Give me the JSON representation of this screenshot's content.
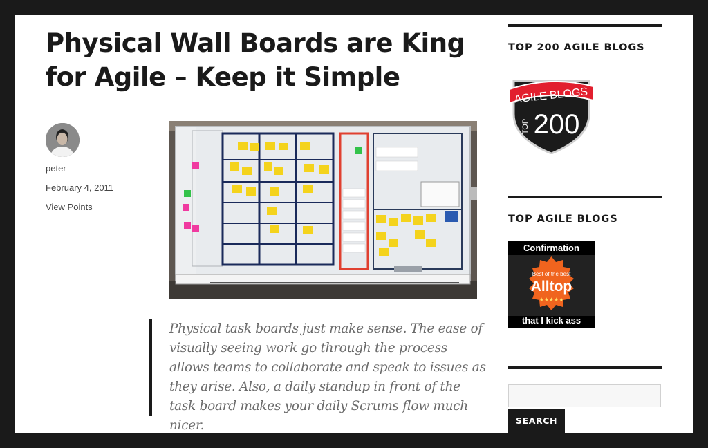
{
  "post": {
    "title": "Physical Wall Boards are King for Agile – Keep it Simple",
    "author": "peter",
    "date": "February 4, 2011",
    "category": "View Points",
    "quote": "Physical task boards just make sense. The ease of visually seeing work go through the process allows teams to collaborate and speak to issues as they arise. Also, a daily standup in front of the task board makes your daily Scrums flow much nicer."
  },
  "sidebar": {
    "widget1": {
      "title": "TOP 200 AGILE BLOGS",
      "badge_line1": "AGILE BLOGS",
      "badge_side": "TOP",
      "badge_number": "200"
    },
    "widget2": {
      "title": "TOP AGILE BLOGS",
      "badge_top": "Confirmation",
      "badge_small": "Best of the best",
      "badge_main": "Alltop",
      "badge_stars": "★★★★★",
      "badge_bottom": "that I kick ass"
    },
    "search": {
      "value": "",
      "button_label": "Search"
    }
  },
  "colors": {
    "text": "#1a1a1a",
    "muted": "#6b6b6b",
    "badge_red": "#e21f2e",
    "alltop_orange": "#f0641e"
  }
}
